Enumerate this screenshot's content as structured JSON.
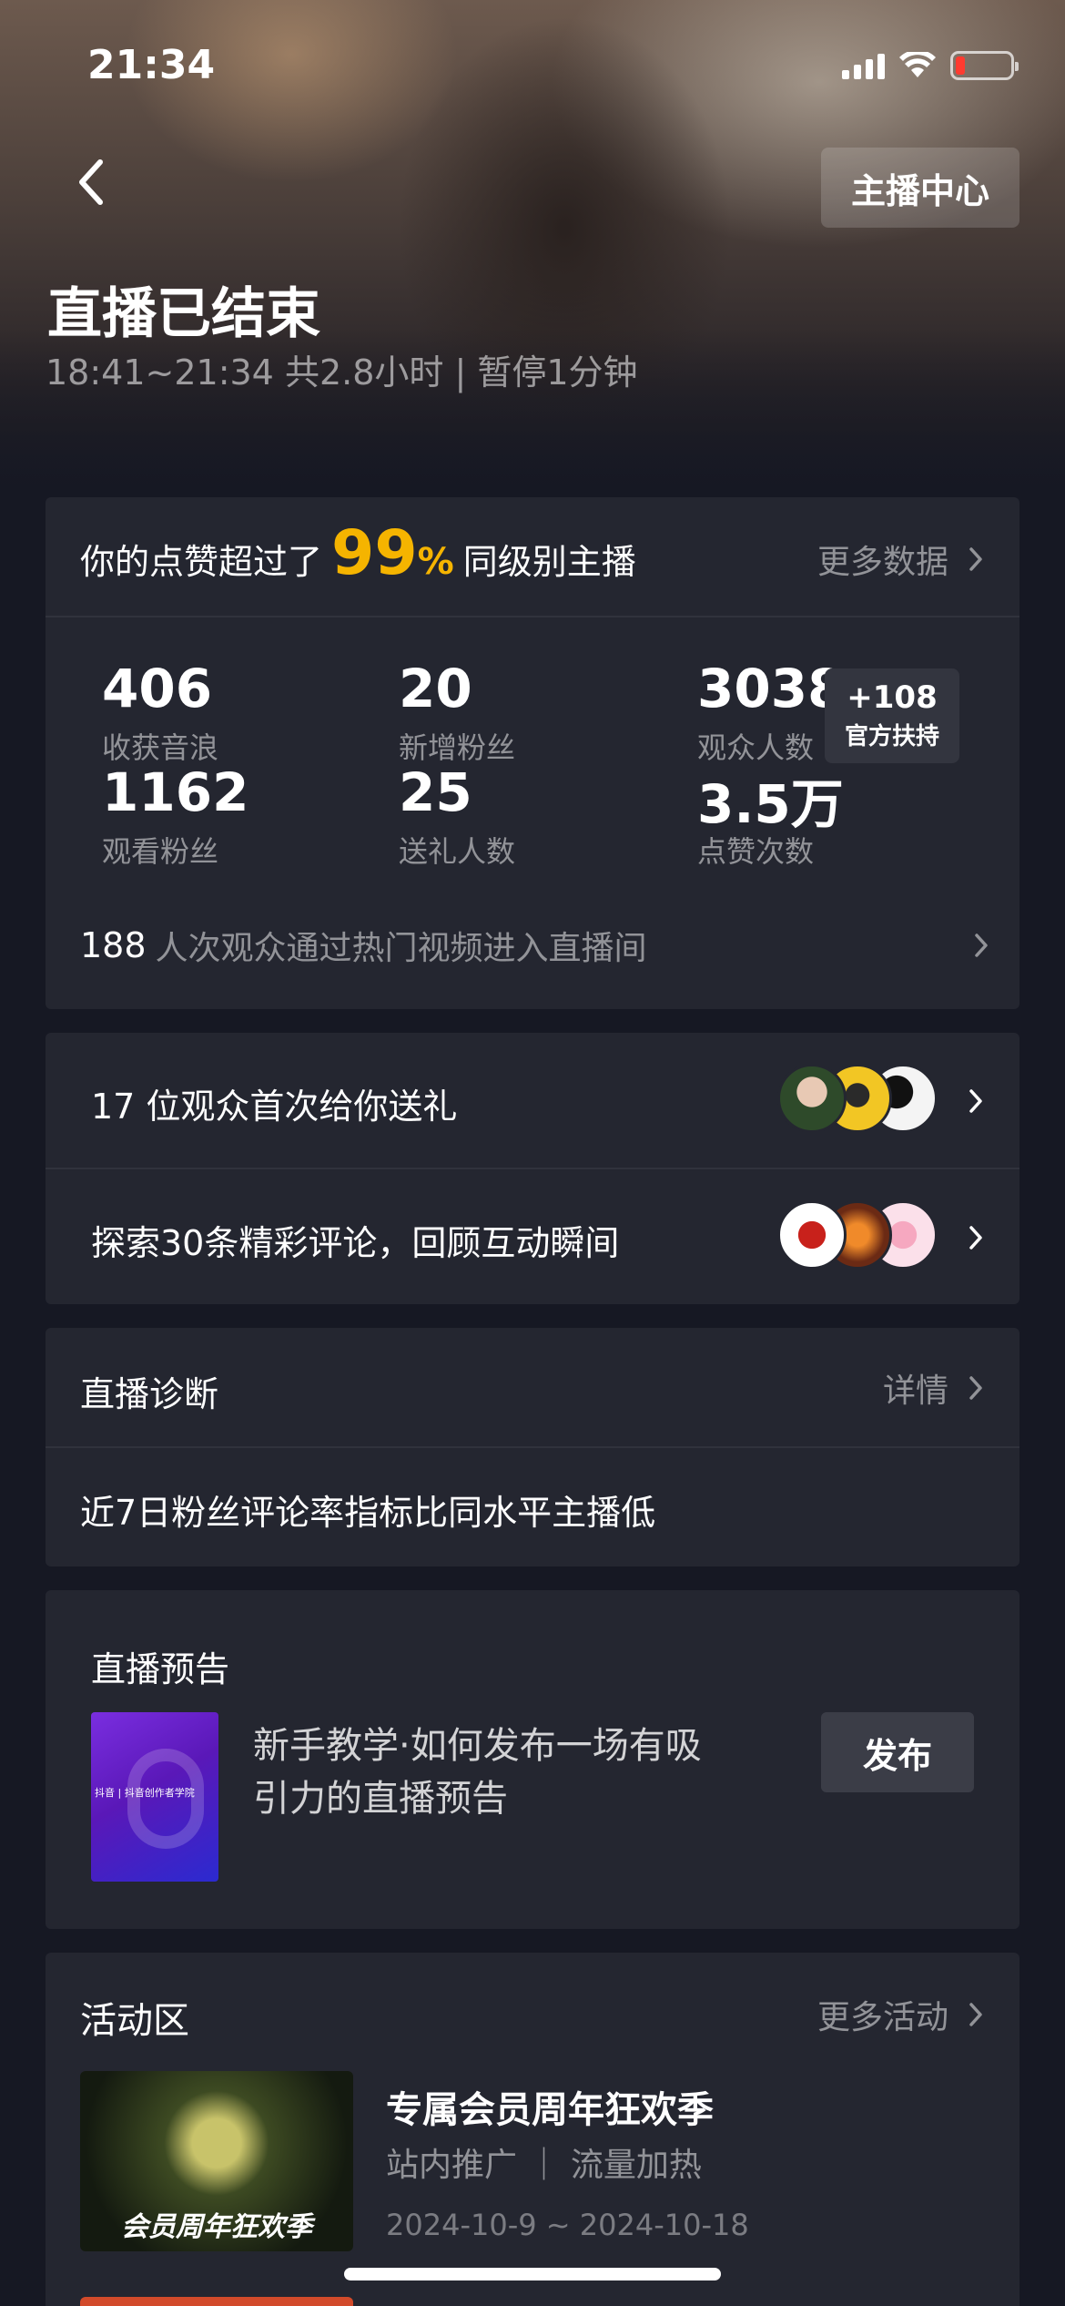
{
  "status_bar": {
    "time": "21:34"
  },
  "header": {
    "anchor_center_label": "主播中心",
    "title": "直播已结束",
    "subtitle": "18:41~21:34 共2.8小时 | 暂停1分钟"
  },
  "stats_card": {
    "like_prefix": "你的点赞超过了",
    "like_percent": "99",
    "like_percent_unit": "%",
    "like_suffix": "同级别主播",
    "more_data_label": "更多数据",
    "stats": [
      {
        "value": "406",
        "label": "收获音浪"
      },
      {
        "value": "20",
        "label": "新增粉丝"
      },
      {
        "value": "3038",
        "label": "观众人数"
      },
      {
        "value": "1162",
        "label": "观看粉丝"
      },
      {
        "value": "25",
        "label": "送礼人数"
      },
      {
        "value": "3.5万",
        "label": "点赞次数"
      }
    ],
    "boost": {
      "value": "+108",
      "label": "官方扶持"
    },
    "hot_video_count": "188",
    "hot_video_text": "人次观众通过热门视频进入直播间"
  },
  "interaction_card": {
    "gift_text": "17 位观众首次给你送礼",
    "comment_text": "探索30条精彩评论，回顾互动瞬间"
  },
  "diagnosis_card": {
    "title": "直播诊断",
    "detail_label": "详情",
    "message": "近7日粉丝评论率指标比同水平主播低"
  },
  "preview_card": {
    "title": "直播预告",
    "thumb_caption": "抖音 | 抖音创作者学院",
    "description_line1": "新手教学·如何发布一场有吸",
    "description_line2": "引力的直播预告",
    "publish_label": "发布"
  },
  "activity_card": {
    "title": "活动区",
    "more_label": "更多活动",
    "event": {
      "thumb_caption": "会员周年狂欢季",
      "name": "专属会员周年狂欢季",
      "tags": "站内推广 ｜ 流量加热",
      "dates": "2024-10-9 ~ 2024-10-18"
    }
  },
  "colors": {
    "accent": "#f5b400",
    "background": "#161823",
    "card": "#242630"
  }
}
